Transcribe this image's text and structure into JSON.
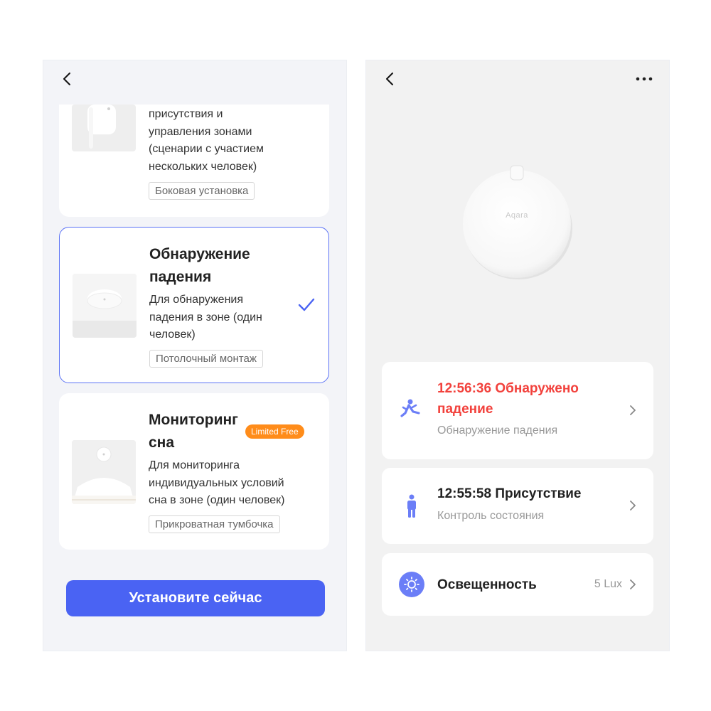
{
  "left": {
    "cards": [
      {
        "desc": "присутствия и\nуправления зонами\n(сценарии с участием\nнескольких человек)",
        "tag": "Боковая установка"
      },
      {
        "title": "Обнаружение\nпадения",
        "desc": "Для обнаружения\nпадения в зоне (один\nчеловек)",
        "tag": "Потолочный монтаж",
        "selected": true
      },
      {
        "title": "Мониторинг\nсна",
        "badge": "Limited Free",
        "desc": "Для мониторинга\nиндивидуальных условий\nсна в зоне (один человек)",
        "tag": "Прикроватная тумбочка"
      }
    ],
    "install_button": "Установите сейчас"
  },
  "right": {
    "device_brand": "Aqara",
    "events": [
      {
        "title": "12:56:36 Обнаружено\nпадение",
        "subtitle": "Обнаружение падения",
        "title_color": "#f2413c"
      },
      {
        "title": "12:55:58 Присутствие",
        "subtitle": "Контроль состояния"
      }
    ],
    "illuminance": {
      "label": "Освещенность",
      "value": "5 Lux"
    }
  },
  "colors": {
    "accent": "#4a63f3",
    "alert": "#f2413c",
    "badge": "#ff8c1a",
    "icon": "#6b7ef7"
  },
  "icons": [
    "back-arrow-icon",
    "checkmark-icon",
    "more-icon",
    "fall-person-icon",
    "standing-person-icon",
    "sun-icon",
    "chevron-right-icon"
  ]
}
